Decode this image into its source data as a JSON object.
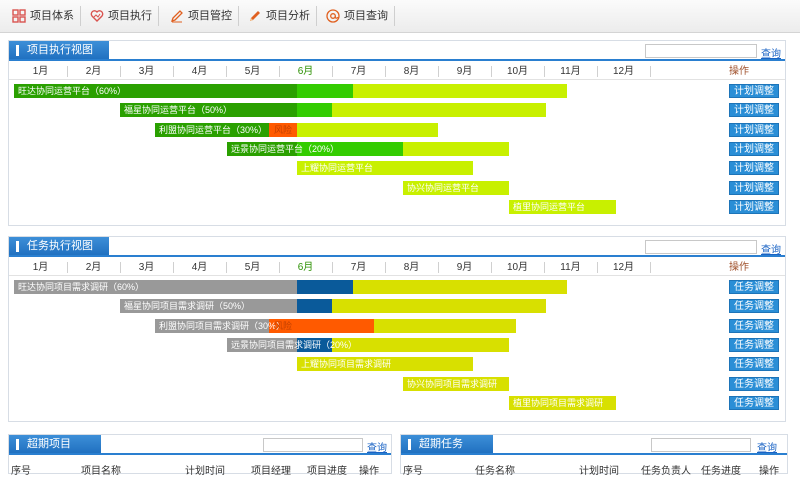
{
  "nav": [
    {
      "label": "项目体系",
      "icon": "grid-icon",
      "color": "#d9534f"
    },
    {
      "label": "项目执行",
      "icon": "heart-chart-icon",
      "color": "#d9534f"
    },
    {
      "label": "项目管控",
      "icon": "pen-icon",
      "color": "#e06020"
    },
    {
      "label": "项目分析",
      "icon": "pencil-icon",
      "color": "#e06020"
    },
    {
      "label": "项目查询",
      "icon": "at-icon",
      "color": "#e06020"
    }
  ],
  "project_view": {
    "title": "项目执行视图",
    "search_link": "查询",
    "months": [
      "1月",
      "2月",
      "3月",
      "4月",
      "5月",
      "6月",
      "7月",
      "8月",
      "9月",
      "10月",
      "11月",
      "12月"
    ],
    "current_month_index": 5,
    "op_header": "操作",
    "rows": [
      {
        "label": "旺达协同运营平台（60%）",
        "button": "计划调整"
      },
      {
        "label": "福星协同运营平台（50%）",
        "button": "计划调整"
      },
      {
        "label": "利盟协同运营平台（30%）",
        "risk": "风险",
        "button": "计划调整"
      },
      {
        "label": "远景协同运营平台（20%）",
        "button": "计划调整"
      },
      {
        "label": "上耀协同运营平台",
        "button": "计划调整"
      },
      {
        "label": "协兴协同运营平台",
        "button": "计划调整"
      },
      {
        "label": "植里协同运营平台",
        "button": "计划调整"
      }
    ]
  },
  "task_view": {
    "title": "任务执行视图",
    "search_link": "查询",
    "months": [
      "1月",
      "2月",
      "3月",
      "4月",
      "5月",
      "6月",
      "7月",
      "8月",
      "9月",
      "10月",
      "11月",
      "12月"
    ],
    "current_month_index": 5,
    "op_header": "操作",
    "rows": [
      {
        "label": "旺达协同项目需求调研（60%）",
        "button": "任务调整"
      },
      {
        "label": "福星协同项目需求调研（50%）",
        "button": "任务调整"
      },
      {
        "label": "利盟协同项目需求调研（30%）",
        "risk": "风险",
        "button": "任务调整"
      },
      {
        "label": "远景协同项目需求调研（20%）",
        "button": "任务调整"
      },
      {
        "label": "上耀协同项目需求调研",
        "button": "任务调整"
      },
      {
        "label": "协兴协同项目需求调研",
        "button": "任务调整"
      },
      {
        "label": "植里协同项目需求调研",
        "button": "任务调整"
      }
    ]
  },
  "overdue_projects": {
    "title": "超期项目",
    "search_link": "查询",
    "columns": [
      "序号",
      "项目名称",
      "计划时间",
      "项目经理",
      "项目进度",
      "操作"
    ]
  },
  "overdue_tasks": {
    "title": "超期任务",
    "search_link": "查询",
    "columns": [
      "序号",
      "任务名称",
      "计划时间",
      "任务负责人",
      "任务进度",
      "操作"
    ]
  },
  "colors": {
    "accent": "#1f6fbf",
    "project_done": "#2aa000",
    "project_now": "#33cc00",
    "project_plan": "#c8f000",
    "task_done": "#999999",
    "task_now": "#0a5a9a",
    "task_plan": "#d8e000",
    "risk": "#ff5a00",
    "button": "#2a8ed6"
  }
}
